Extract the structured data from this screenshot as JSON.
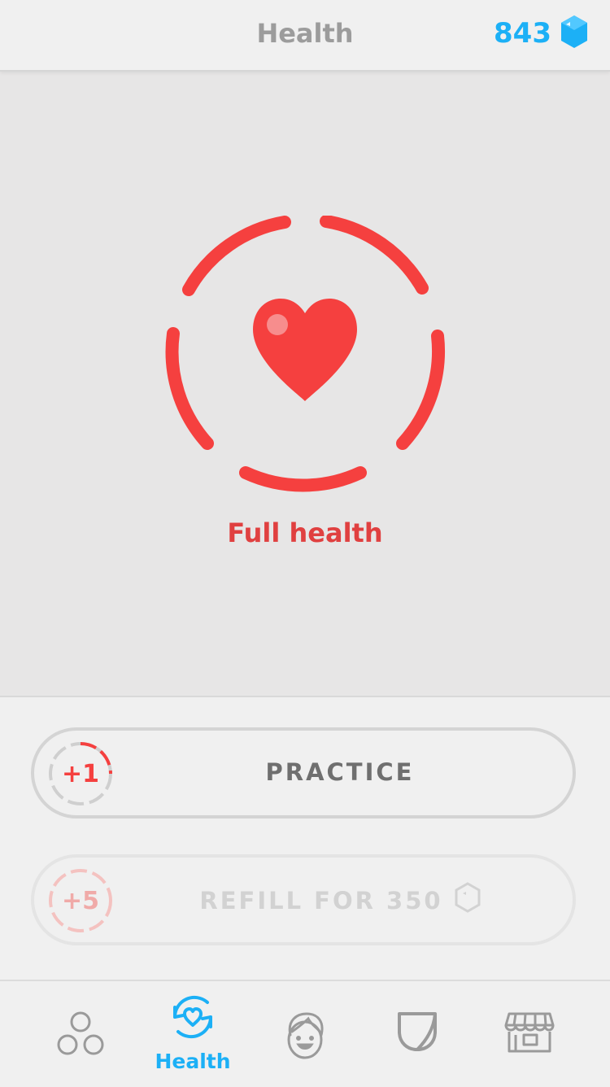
{
  "header": {
    "title": "Health",
    "gems": "843",
    "gem_icon": "gem-icon"
  },
  "main": {
    "status": "Full health",
    "heart_icon": "heart-icon"
  },
  "actions": {
    "practice": {
      "badge": "+1",
      "label": "PRACTICE"
    },
    "refill": {
      "badge": "+5",
      "label": "REFILL FOR 350",
      "currency_icon": "gem-outline-icon"
    }
  },
  "tabbar": {
    "tabs": [
      {
        "icon": "learn-circles-icon",
        "label": ""
      },
      {
        "icon": "health-refresh-icon",
        "label": "Health",
        "active": true
      },
      {
        "icon": "profile-face-icon",
        "label": ""
      },
      {
        "icon": "league-shield-icon",
        "label": ""
      },
      {
        "icon": "shop-icon",
        "label": ""
      }
    ]
  },
  "colors": {
    "accent": "#1cb0f6",
    "heart": "#f5403f",
    "status_text": "#e04040"
  }
}
